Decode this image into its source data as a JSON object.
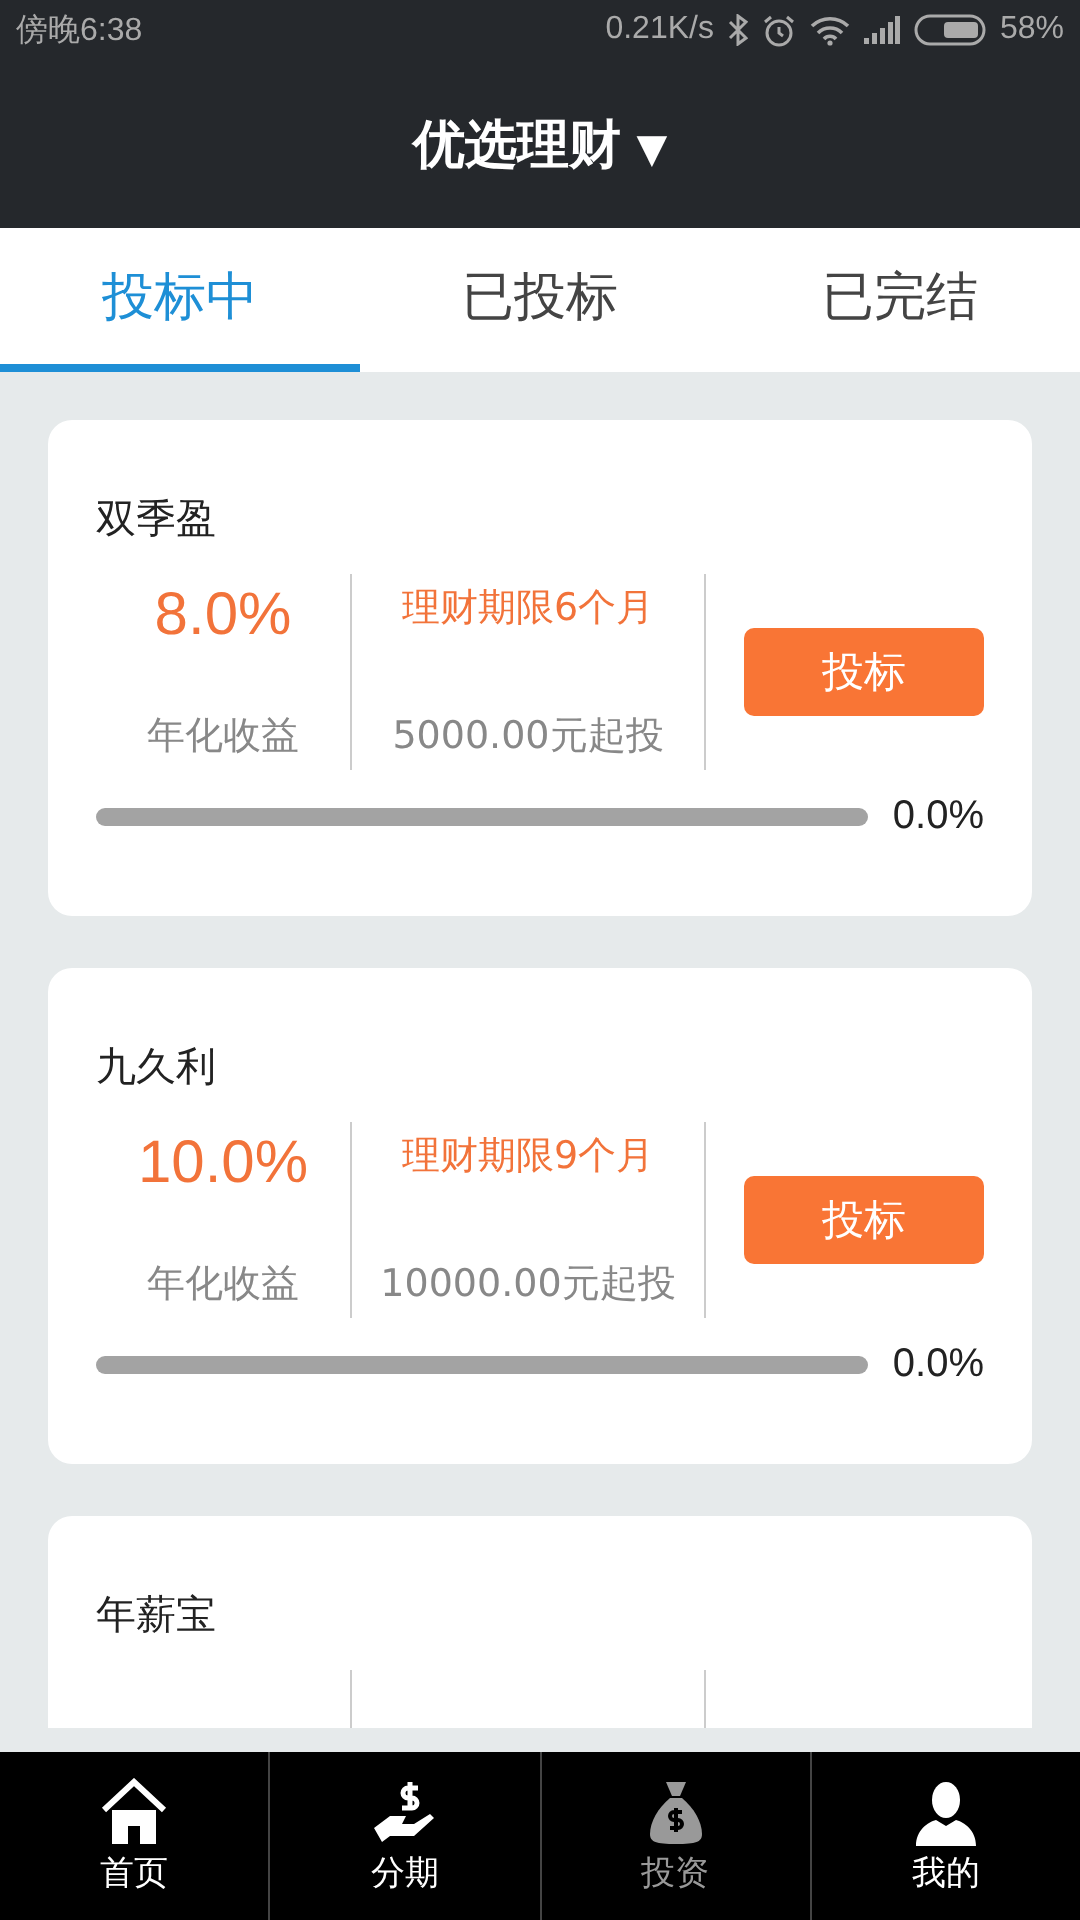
{
  "status_bar": {
    "time": "傍晚6:38",
    "speed": "0.21K/s",
    "battery": "58%"
  },
  "header": {
    "title": "优选理财",
    "caret": "▼"
  },
  "tabs": [
    {
      "label": "投标中",
      "selected": true
    },
    {
      "label": "已投标",
      "selected": false
    },
    {
      "label": "已完结",
      "selected": false
    }
  ],
  "products": [
    {
      "name": "双季盈",
      "rate": "8.0%",
      "rate_label": "年化收益",
      "term": "理财期限6个月",
      "minimum": "5000.00元起投",
      "button": "投标",
      "level": 0,
      "progress": "0.0%"
    },
    {
      "name": "九久利",
      "rate": "10.0%",
      "rate_label": "年化收益",
      "term": "理财期限9个月",
      "minimum": "10000.00元起投",
      "button": "投标",
      "level": 0,
      "progress": "0.0%"
    },
    {
      "name": "年薪宝"
    }
  ],
  "bottom_nav": [
    {
      "label": "首页",
      "kind": "home",
      "selected": false
    },
    {
      "label": "分期",
      "kind": "installment",
      "selected": false
    },
    {
      "label": "投资",
      "kind": "invest",
      "selected": true
    },
    {
      "label": "我的",
      "kind": "profile",
      "selected": false
    }
  ]
}
